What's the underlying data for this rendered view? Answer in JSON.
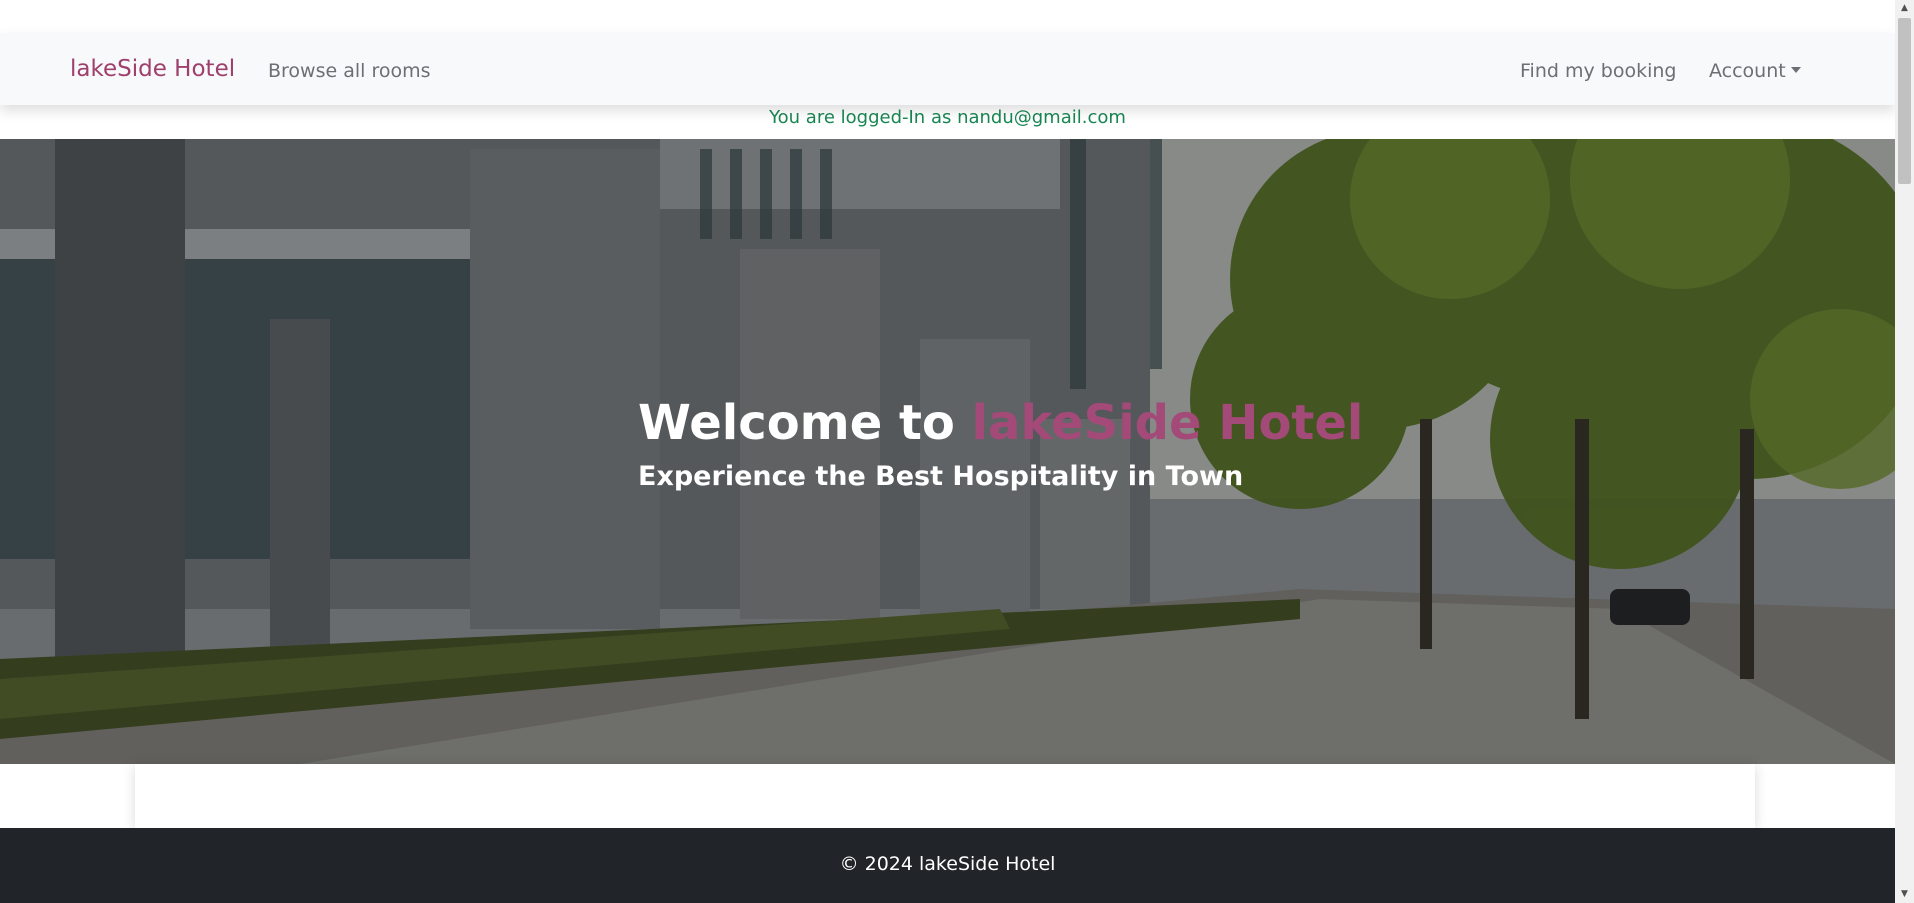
{
  "navbar": {
    "brand": "lakeSide Hotel",
    "links": {
      "browse_rooms": "Browse all rooms",
      "find_booking": "Find my booking",
      "account": "Account"
    }
  },
  "notice": {
    "logged_in_text": "You are logged-In as nandu@gmail.com"
  },
  "hero": {
    "title_prefix": "Welcome to ",
    "title_brand": "lakeSide Hotel",
    "subtitle": "Experience the Best Hospitality in Town",
    "background_image": "hotel-street-photo"
  },
  "footer": {
    "copyright": "© 2024 lakeSide Hotel"
  },
  "colors": {
    "brand": "#9e3f6d",
    "navbar_bg": "#f8f9fa",
    "success_text": "#198754",
    "footer_bg": "#212529",
    "nav_link": "#6c6f73"
  }
}
